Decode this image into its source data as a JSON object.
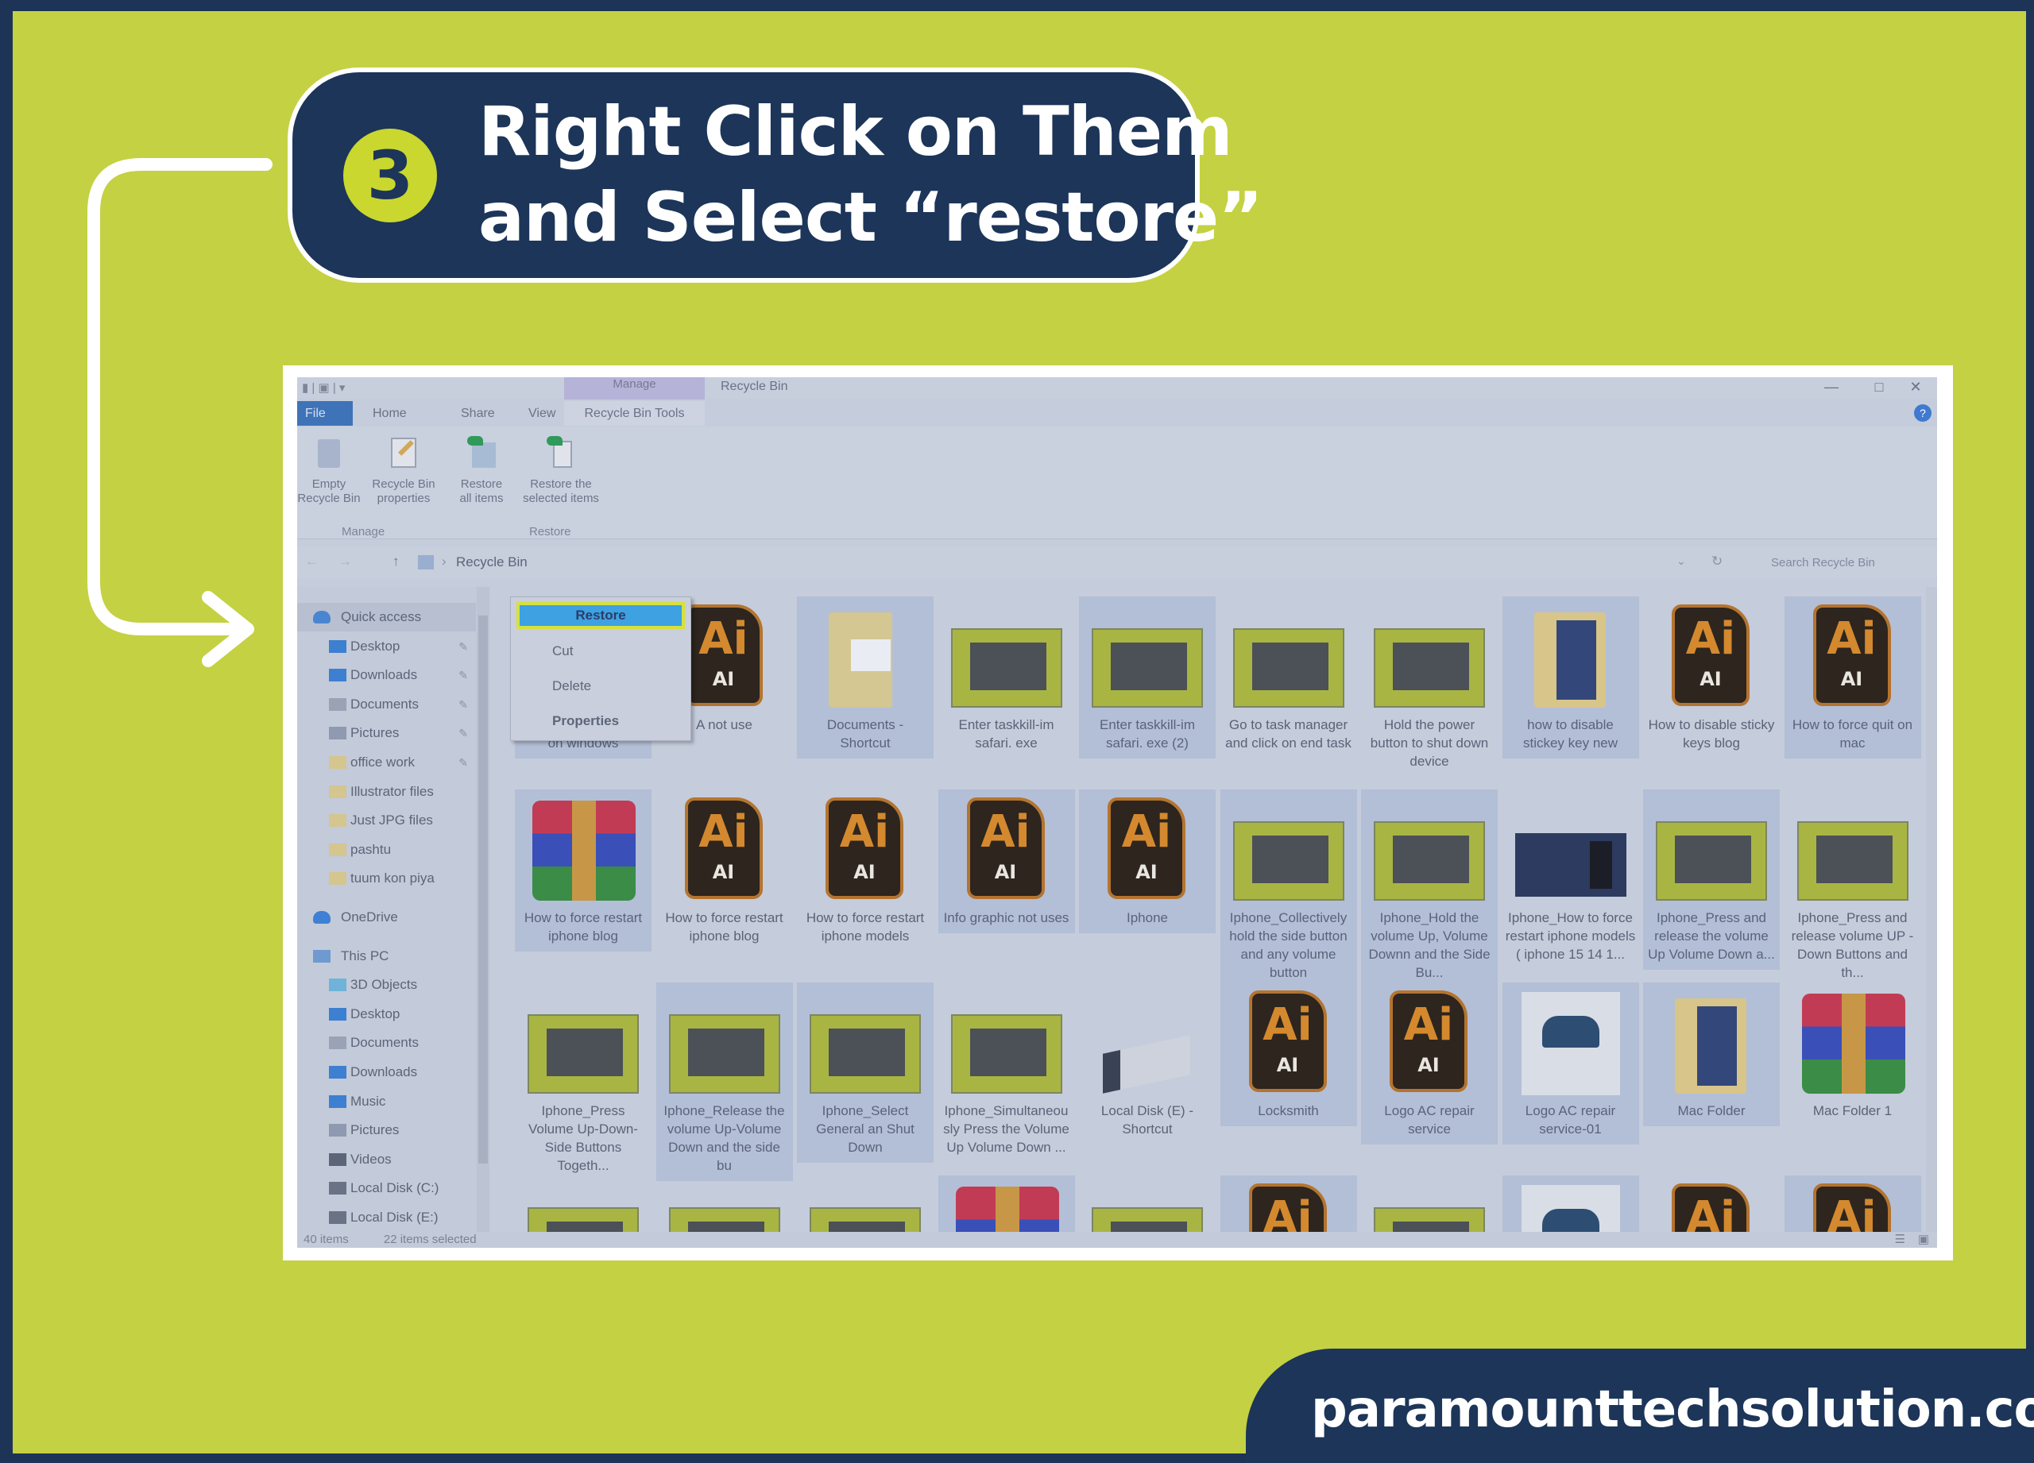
{
  "banner": {
    "step": "3",
    "line1": "Right Click on Them",
    "line2": "and Select “restore”"
  },
  "footer": {
    "site": "paramounttechsolution.com"
  },
  "colors": {
    "background": "#c4d142",
    "navy": "#1c3559",
    "restore_highlight": "#3da1e2",
    "restore_outline": "#d6e13c"
  },
  "window": {
    "title": "Recycle Bin",
    "context_tab": "Manage",
    "controls": {
      "minimize": "—",
      "maximize": "□",
      "close": "✕"
    },
    "help": "?"
  },
  "ribbon": {
    "tabs": [
      "File",
      "Home",
      "Share",
      "View",
      "Recycle Bin Tools"
    ],
    "buttons": [
      {
        "label1": "Empty",
        "label2": "Recycle Bin",
        "icon": "empty-recycle-bin-icon"
      },
      {
        "label1": "Recycle Bin",
        "label2": "properties",
        "icon": "properties-icon"
      },
      {
        "label1": "Restore",
        "label2": "all items",
        "icon": "restore-all-icon"
      },
      {
        "label1": "Restore the",
        "label2": "selected items",
        "icon": "restore-selected-icon"
      }
    ],
    "groups": [
      "Manage",
      "Restore"
    ]
  },
  "address": {
    "path": "Recycle Bin",
    "separator": "›",
    "search_placeholder": "Search Recycle Bin"
  },
  "nav": [
    {
      "label": "Quick access",
      "type": "header",
      "icon": "star",
      "selected": true
    },
    {
      "label": "Desktop",
      "icon": "desktop",
      "pinned": true
    },
    {
      "label": "Downloads",
      "icon": "download",
      "pinned": true
    },
    {
      "label": "Documents",
      "icon": "documents",
      "pinned": true
    },
    {
      "label": "Pictures",
      "icon": "pictures",
      "pinned": true
    },
    {
      "label": "office work",
      "icon": "folder",
      "pinned": true
    },
    {
      "label": "Illustrator files",
      "icon": "folder"
    },
    {
      "label": "Just JPG files",
      "icon": "folder"
    },
    {
      "label": "pashtu",
      "icon": "folder"
    },
    {
      "label": "tuum kon piya",
      "icon": "folder"
    },
    {
      "label": "OneDrive",
      "type": "header",
      "icon": "cloud"
    },
    {
      "label": "This PC",
      "type": "header",
      "icon": "pc"
    },
    {
      "label": "3D Objects",
      "icon": "cube"
    },
    {
      "label": "Desktop",
      "icon": "desktop"
    },
    {
      "label": "Documents",
      "icon": "documents"
    },
    {
      "label": "Downloads",
      "icon": "download"
    },
    {
      "label": "Music",
      "icon": "music"
    },
    {
      "label": "Pictures",
      "icon": "pictures"
    },
    {
      "label": "Videos",
      "icon": "videos"
    },
    {
      "label": "Local Disk (C:)",
      "icon": "disk"
    },
    {
      "label": "Local Disk (E:)",
      "icon": "disk"
    }
  ],
  "files": [
    {
      "label": "on how to force quit on windows",
      "type": "ai",
      "selected": true
    },
    {
      "label": "A not use",
      "type": "ai"
    },
    {
      "label": "Documents - Shortcut",
      "type": "folder-shortcut",
      "selected": true
    },
    {
      "label": "Enter taskkill-im safari. exe",
      "type": "thumb"
    },
    {
      "label": "Enter taskkill-im safari. exe (2)",
      "type": "thumb",
      "selected": true
    },
    {
      "label": "Go to task manager and click on end task",
      "type": "thumb"
    },
    {
      "label": "Hold the power button to shut down device",
      "type": "thumb"
    },
    {
      "label": "how to disable stickey key new",
      "type": "folder",
      "selected": true
    },
    {
      "label": "How to disable sticky keys blog",
      "type": "ai"
    },
    {
      "label": "How to force quit on mac",
      "type": "ai",
      "selected": true
    },
    {
      "label": "How to force restart iphone blog",
      "type": "rar",
      "selected": true
    },
    {
      "label": "How to force restart iphone blog",
      "type": "ai"
    },
    {
      "label": "How to force restart iphone models",
      "type": "ai"
    },
    {
      "label": "Info graphic not uses",
      "type": "ai",
      "selected": true
    },
    {
      "label": "Iphone",
      "type": "ai",
      "selected": true
    },
    {
      "label": "Iphone_Collectively hold the side button and any volume button",
      "type": "thumb",
      "selected": true
    },
    {
      "label": "Iphone_Hold the volume Up, Volume Downn and the Side Bu...",
      "type": "thumb",
      "selected": true
    },
    {
      "label": "Iphone_How to force restart iphone models ( iphone 15 14 1...",
      "type": "thumb-dark"
    },
    {
      "label": "Iphone_Press and release the volume Up Volume Down a...",
      "type": "thumb",
      "selected": true
    },
    {
      "label": "Iphone_Press and release volume UP - Down Buttons and th...",
      "type": "thumb"
    },
    {
      "label": "Iphone_Press Volume Up-Down-Side Buttons Togeth...",
      "type": "thumb"
    },
    {
      "label": "Iphone_Release the volume Up-Volume Down and the side bu",
      "type": "thumb",
      "selected": true
    },
    {
      "label": "Iphone_Select General an Shut Down",
      "type": "thumb",
      "selected": true
    },
    {
      "label": "Iphone_Simultaneously Press the Volume Up Volume Down ...",
      "type": "thumb"
    },
    {
      "label": "Local Disk (E) - Shortcut",
      "type": "disk"
    },
    {
      "label": "Locksmith",
      "type": "ai",
      "selected": true
    },
    {
      "label": "Logo AC repair service",
      "type": "ai",
      "selected": true
    },
    {
      "label": "Logo AC repair service-01",
      "type": "logo",
      "selected": true
    },
    {
      "label": "Mac Folder",
      "type": "folder",
      "selected": true
    },
    {
      "label": "Mac Folder 1",
      "type": "rar"
    },
    {
      "label": "",
      "type": "thumb"
    },
    {
      "label": "",
      "type": "thumb"
    },
    {
      "label": "",
      "type": "thumb"
    },
    {
      "label": "",
      "type": "rar",
      "selected": true
    },
    {
      "label": "",
      "type": "thumb"
    },
    {
      "label": "",
      "type": "ai",
      "selected": true
    },
    {
      "label": "",
      "type": "thumb"
    },
    {
      "label": "",
      "type": "logo",
      "selected": true
    },
    {
      "label": "",
      "type": "ai"
    },
    {
      "label": "",
      "type": "ai",
      "selected": true
    }
  ],
  "context_menu": {
    "items": [
      "Restore",
      "Cut",
      "Delete",
      "Properties"
    ],
    "highlighted": "Restore"
  },
  "status": {
    "count": "40 items",
    "selected": "22 items selected"
  }
}
